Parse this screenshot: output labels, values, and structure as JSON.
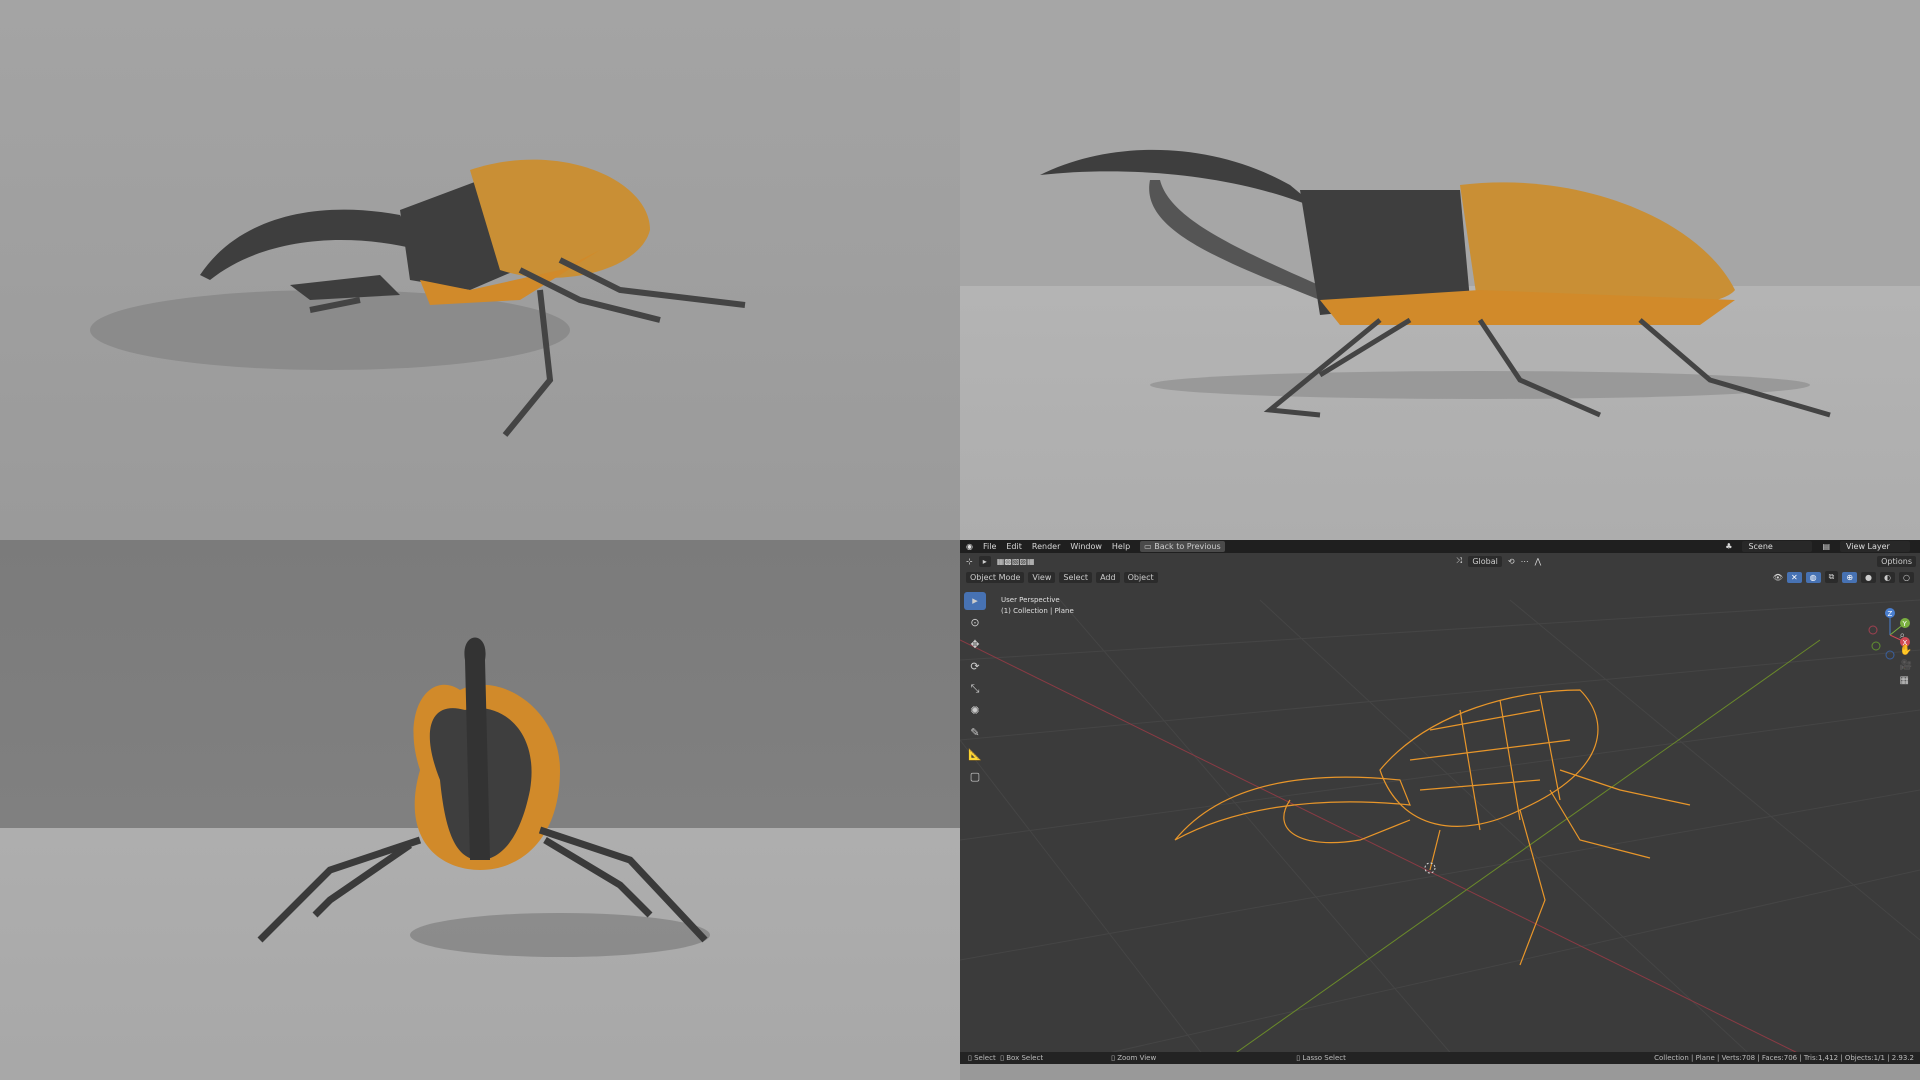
{
  "menu": {
    "items": [
      "File",
      "Edit",
      "Render",
      "Window",
      "Help"
    ],
    "back": "Back to Previous",
    "scene": "Scene",
    "view_layer": "View Layer"
  },
  "toolbar": {
    "orientation": "Global",
    "options": "Options"
  },
  "header": {
    "mode": "Object Mode",
    "items": [
      "View",
      "Select",
      "Add",
      "Object"
    ]
  },
  "viewport": {
    "perspective": "User Perspective",
    "collection": "(1) Collection | Plane",
    "gizmo": {
      "z": "Z",
      "y": "Y",
      "x": "X"
    }
  },
  "status": {
    "select": "Select",
    "box_select": "Box Select",
    "zoom": "Zoom View",
    "lasso": "Lasso Select",
    "stats": "Collection | Plane | Verts:708 | Faces:706 | Tris:1,412 | Objects:1/1 | 2.93.2"
  },
  "colors": {
    "body_orange": "#d18a2a",
    "shell": "#c98f35",
    "dark": "#3c3c3c",
    "wire": "#e8962a",
    "accent": "#4772b3"
  }
}
